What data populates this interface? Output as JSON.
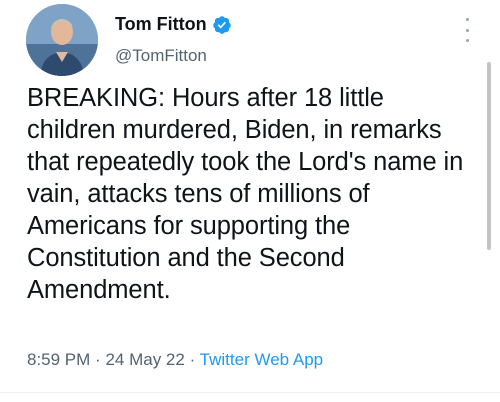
{
  "author": {
    "display_name": "Tom Fitton",
    "handle": "@TomFitton",
    "verified": true,
    "avatar_icon": "profile-photo"
  },
  "tweet": {
    "text": "BREAKING: Hours after 18 little children murdered, Biden, in remarks that repeatedly took the Lord's name in vain, attacks tens of millions of Americans for supporting the Constitution and the Second Amendment.",
    "time": "8:59 PM",
    "separator": "·",
    "date": "24 May 22",
    "source": "Twitter Web App"
  },
  "colors": {
    "text": "#0f1419",
    "muted": "#536471",
    "accent": "#1d9bf0"
  },
  "icons": {
    "more": "more-options-icon",
    "verified": "verified-badge-icon"
  }
}
